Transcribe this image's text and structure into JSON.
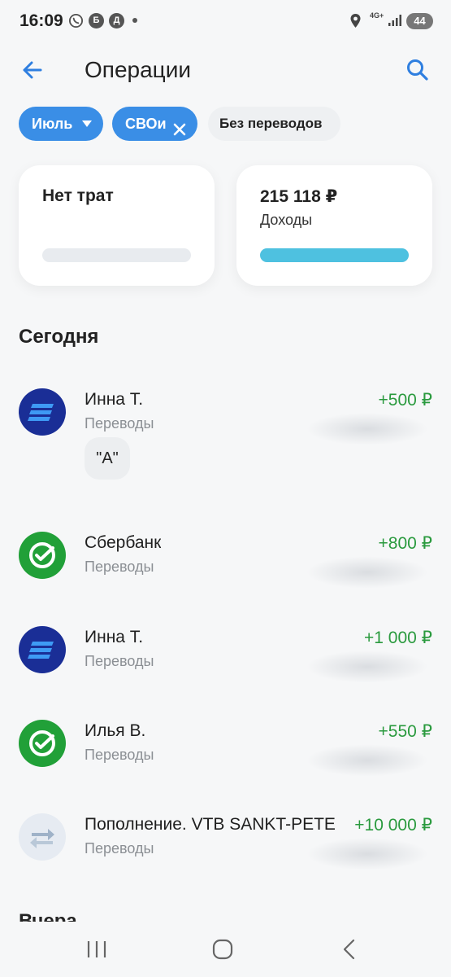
{
  "status_bar": {
    "time": "16:09",
    "icons": [
      "whatsapp-icon",
      "b-icon",
      "d-icon"
    ],
    "b_letter": "Б",
    "d_letter": "Д",
    "network": "4G+",
    "battery": "44"
  },
  "header": {
    "title": "Операции"
  },
  "filters": {
    "month": "Июль",
    "svoi": "СВОи",
    "no_transfers": "Без переводов"
  },
  "summary": {
    "expenses_label": "Нет трат",
    "income_amount": "215 118 ₽",
    "income_label": "Доходы",
    "income_fill": 1.0
  },
  "sections": {
    "today": "Сегодня",
    "yesterday": "Вчера"
  },
  "operations": [
    {
      "name": "Инна Т.",
      "category": "Переводы",
      "amount": "+500 ₽",
      "note": "\"А\"",
      "icon": "vtb-icon"
    },
    {
      "name": "Сбербанк",
      "category": "Переводы",
      "amount": "+800 ₽",
      "icon": "sber-icon"
    },
    {
      "name": "Инна Т.",
      "category": "Переводы",
      "amount": "+1 000 ₽",
      "icon": "vtb-icon"
    },
    {
      "name": "Илья В.",
      "category": "Переводы",
      "amount": "+550 ₽",
      "icon": "sber-icon"
    },
    {
      "name": "Пополнение. VTB SANKT-PETE",
      "category": "Переводы",
      "amount": "+10 000 ₽",
      "icon": "transfer-icon"
    }
  ],
  "colors": {
    "accent": "#3a8ee6",
    "income_green": "#2a9a3e",
    "income_bar": "#4ec1e0",
    "vtb_blue": "#1a2e96",
    "sber_green": "#21a038"
  }
}
